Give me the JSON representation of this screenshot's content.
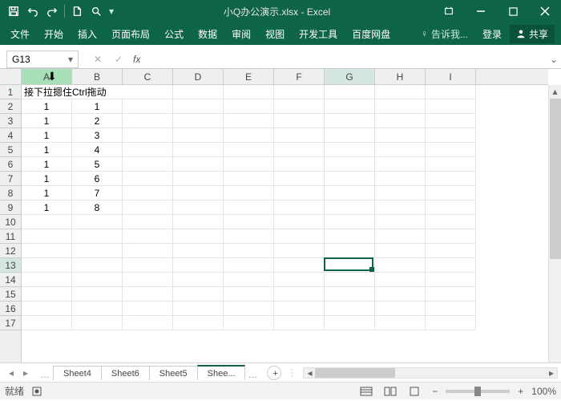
{
  "title": "小Q办公演示.xlsx - Excel",
  "qat": {
    "save": "保存",
    "undo": "撤销",
    "redo": "重做",
    "new": "新建",
    "preview": "预览"
  },
  "ribbon": {
    "tabs": [
      "文件",
      "开始",
      "插入",
      "页面布局",
      "公式",
      "数据",
      "审阅",
      "视图",
      "开发工具",
      "百度网盘"
    ],
    "tell_me": "告诉我...",
    "login": "登录",
    "share": "共享"
  },
  "name_box": "G13",
  "fx_label": "fx",
  "columns": [
    "A",
    "B",
    "C",
    "D",
    "E",
    "F",
    "G",
    "H",
    "I"
  ],
  "rows": [
    "1",
    "2",
    "3",
    "4",
    "5",
    "6",
    "7",
    "8",
    "9",
    "10",
    "11",
    "12",
    "13",
    "14",
    "15",
    "16",
    "17"
  ],
  "grid": {
    "r1": {
      "A": "接下拉摁住Ctrl拖动"
    },
    "r2": {
      "A": "1",
      "B": "1"
    },
    "r3": {
      "A": "1",
      "B": "2"
    },
    "r4": {
      "A": "1",
      "B": "3"
    },
    "r5": {
      "A": "1",
      "B": "4"
    },
    "r6": {
      "A": "1",
      "B": "5"
    },
    "r7": {
      "A": "1",
      "B": "6"
    },
    "r8": {
      "A": "1",
      "B": "7"
    },
    "r9": {
      "A": "1",
      "B": "8"
    }
  },
  "active_cell": {
    "row": 13,
    "col": "G"
  },
  "sheets": {
    "tabs": [
      "Sheet4",
      "Sheet6",
      "Sheet5",
      "Shee..."
    ],
    "active": 3
  },
  "status": {
    "ready": "就绪",
    "zoom": "100%"
  }
}
